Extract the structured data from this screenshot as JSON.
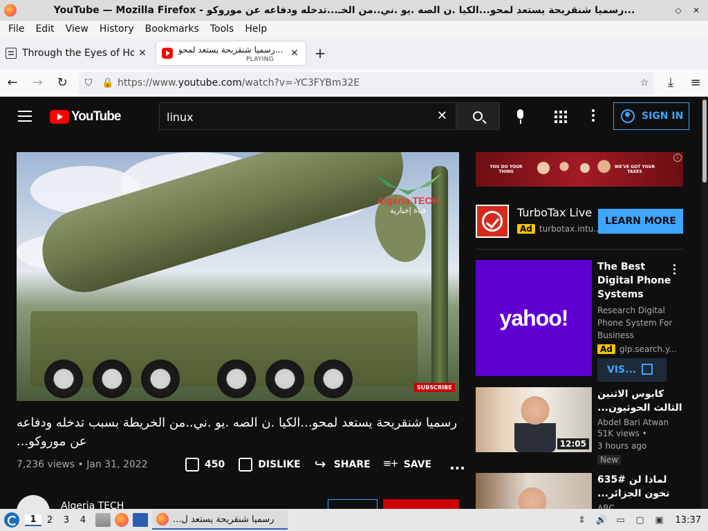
{
  "window": {
    "title": "YouTube — Mozilla Firefox - رسميا شنقريحة يستعد لمحو...الكيا .ن الصه .يو .ني..من الخـ...تدخله ودفاعه عن موروكو...",
    "controls": [
      "◇",
      "✕"
    ]
  },
  "menu": [
    "File",
    "Edit",
    "View",
    "History",
    "Bookmarks",
    "Tools",
    "Help"
  ],
  "tabs": [
    {
      "label": "Through the Eyes of Hope",
      "close": "✕"
    },
    {
      "label": "رسميا شنقريحة يستعد لمحو...",
      "status": "PLAYING",
      "close": "✕"
    }
  ],
  "new_tab": "+",
  "nav": {
    "back": "←",
    "forward": "→",
    "reload": "↻",
    "shield": "⛉",
    "lock": "🔒",
    "url_prefix": "https://www.",
    "url_domain": "youtube.com",
    "url_path": "/watch?v=-YC3FYBm32E",
    "star": "☆",
    "download": "⤓",
    "menu": "≡"
  },
  "youtube": {
    "logo_text": "YouTube",
    "search_value": "linux",
    "clear": "✕",
    "sign_in": "SIGN IN",
    "video": {
      "watermark_line1": "Algeria TECH",
      "watermark_line2": "قناة إخبارية",
      "subscribe_overlay": "SUBSCRIBE",
      "title_line1": "رسميا شنقريحة يستعد لمحو...الكيا .ن الصه .يو .ني..من الخريطة بسبب تدخله ودفاعه",
      "title_line2": "عن موروكو...",
      "views": "7,236 views",
      "dot": "•",
      "date": "Jan 31, 2022",
      "likes": "450",
      "dislike": "DISLIKE",
      "share": "SHARE",
      "save": "SAVE",
      "more": "...",
      "channel_name": "Algeria TECH"
    },
    "ads": {
      "banner_left": "YOU DO YOUR THING",
      "banner_right": "WE'VE GOT YOUR TAXES",
      "info": "i",
      "turbotax_name": "TurboTax Live",
      "ad_label": "Ad",
      "turbotax_domain": "turbotax.intu...",
      "learn_more": "LEARN MORE",
      "yahoo_logo": "yahoo!",
      "yahoo_title": "The Best Digital Phone Systems",
      "yahoo_desc": "Research Digital Phone System For Business",
      "yahoo_domain": "glp.search.y...",
      "visit": "VIS..."
    },
    "recommended": [
      {
        "title": "كابوس الاثنين الثالث الحوثيون...",
        "channel": "Abdel Bari Atwan",
        "views": "51K views •",
        "ago": "3 hours ago",
        "badge": "New",
        "duration": "12:05"
      },
      {
        "title": "لماذا لن #635 تخون الجزائر...",
        "channel": "ABC"
      }
    ]
  },
  "taskbar": {
    "workspaces": [
      "1",
      "2",
      "3",
      "4"
    ],
    "task_label": "رسميا شنقريحة يستعد ل...",
    "clock": "13:37"
  }
}
